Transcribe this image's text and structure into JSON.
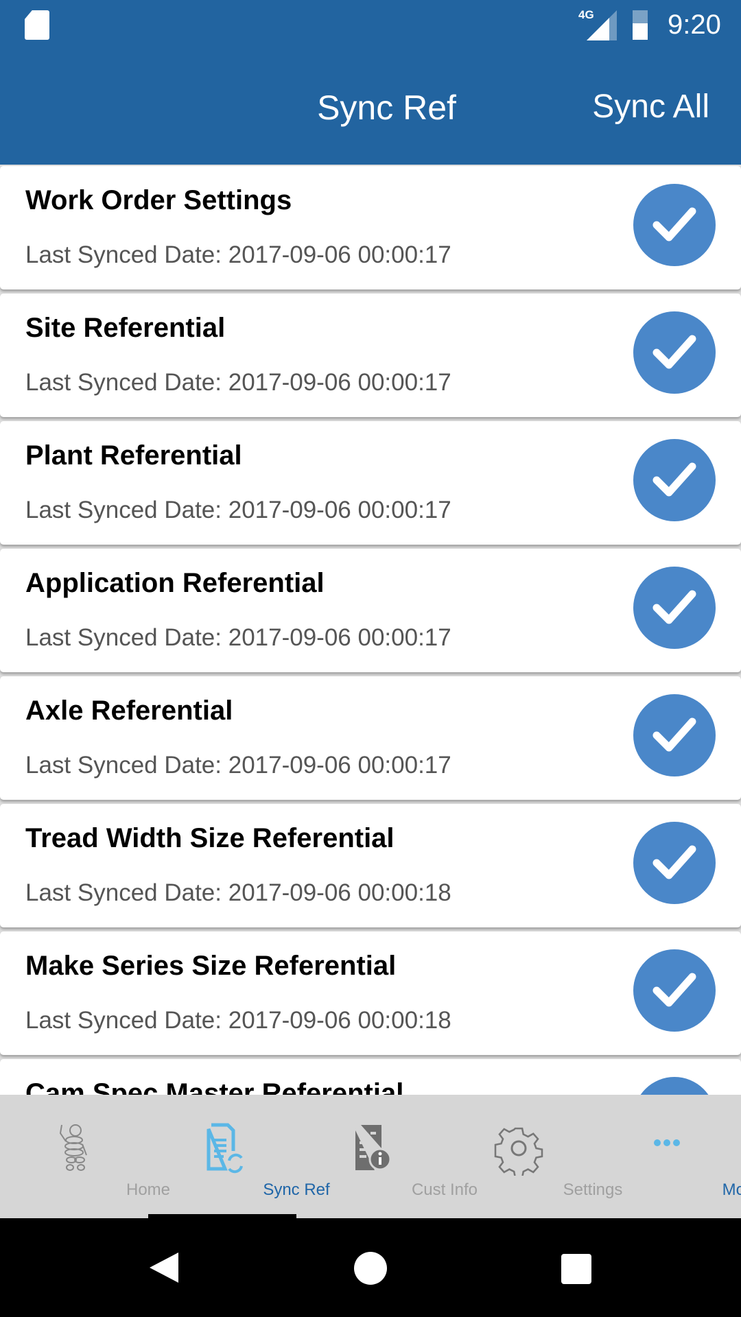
{
  "status_bar": {
    "time": "9:20",
    "network": "4G",
    "icons": [
      "sd-card-icon",
      "signal-icon",
      "battery-charging-icon"
    ]
  },
  "header": {
    "title": "Sync Ref",
    "action_label": "Sync All"
  },
  "colors": {
    "header": "#2264a0",
    "check": "#4a87c9",
    "active_tab": "#2066a8"
  },
  "items": [
    {
      "title": "Work Order Settings",
      "date": "Last Synced Date: 2017-09-06 00:00:17"
    },
    {
      "title": "Site Referential",
      "date": "Last Synced Date: 2017-09-06 00:00:17"
    },
    {
      "title": "Plant Referential",
      "date": "Last Synced Date: 2017-09-06 00:00:17"
    },
    {
      "title": "Application Referential",
      "date": "Last Synced Date: 2017-09-06 00:00:17"
    },
    {
      "title": "Axle Referential",
      "date": "Last Synced Date: 2017-09-06 00:00:17"
    },
    {
      "title": "Tread Width Size Referential",
      "date": "Last Synced Date: 2017-09-06 00:00:18"
    },
    {
      "title": "Make Series Size Referential",
      "date": "Last Synced Date: 2017-09-06 00:00:18"
    },
    {
      "title": "Cam Spec Master Referential",
      "date": ""
    }
  ],
  "tabs": [
    {
      "label": "Home",
      "icon": "michelin-man-icon"
    },
    {
      "label": "Sync Ref",
      "icon": "document-sync-icon"
    },
    {
      "label": "Cust Info",
      "icon": "document-info-icon"
    },
    {
      "label": "Settings",
      "icon": "gear-icon"
    },
    {
      "label": "More",
      "icon": "more-dots-icon"
    }
  ],
  "active_tab": "Sync Ref"
}
